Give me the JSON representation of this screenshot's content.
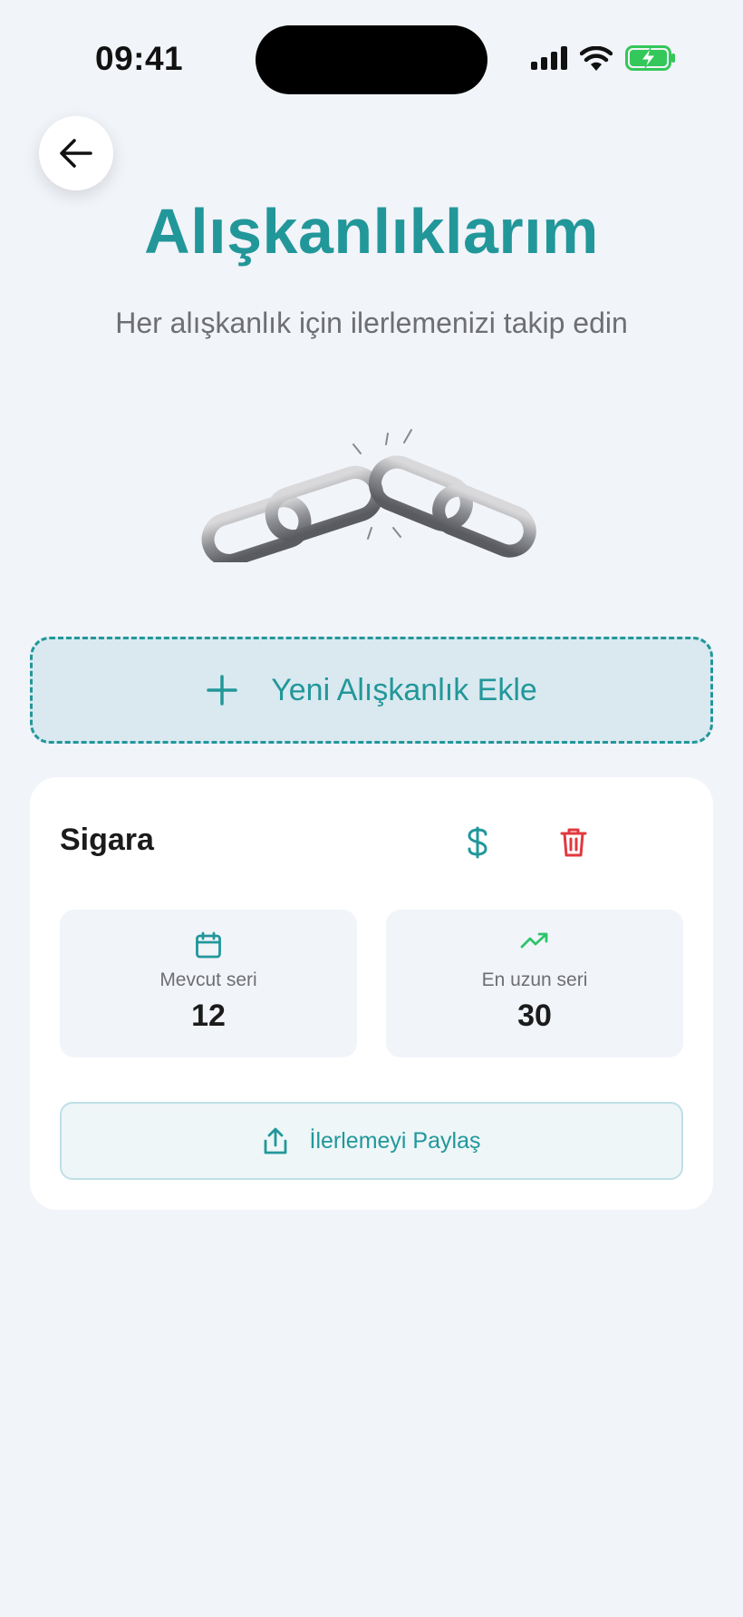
{
  "status_bar": {
    "time": "09:41"
  },
  "header": {
    "title": "Alışkanlıklarım",
    "subtitle": "Her alışkanlık için ilerlemenizi takip edin"
  },
  "add_habit": {
    "label": "Yeni Alışkanlık Ekle",
    "icon": "plus-icon"
  },
  "habit": {
    "name": "Sigara",
    "actions": [
      {
        "icon": "dollar-icon",
        "color": "#22979a"
      },
      {
        "icon": "trash-icon",
        "color": "#e0393e"
      }
    ],
    "stats": [
      {
        "icon": "calendar-icon",
        "label": "Mevcut seri",
        "value": "12",
        "color": "#22979a"
      },
      {
        "icon": "trending-up-icon",
        "label": "En uzun seri",
        "value": "30",
        "color": "#2ec46b"
      }
    ],
    "share_label": "İlerlemeyi Paylaş"
  },
  "colors": {
    "accent": "#22979a",
    "background": "#f1f4f9",
    "danger": "#e0393e",
    "success": "#2ec46b"
  }
}
